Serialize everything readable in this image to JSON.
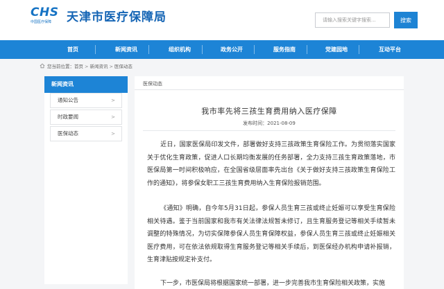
{
  "header": {
    "logo_mark": "CHS",
    "logo_sub": "中国医疗保障",
    "site_title": "天津市医疗保障局",
    "search_placeholder": "请输入搜索关键字搜索...",
    "search_button": "搜索",
    "brand_color": "#1d84d6"
  },
  "nav": {
    "items": [
      "首页",
      "新闻资讯",
      "组织机构",
      "政务公开",
      "服务指南",
      "党建园地",
      "互动平台"
    ]
  },
  "breadcrumb": {
    "prefix": "您当前位置：",
    "items": [
      "首页",
      "新闻资讯",
      "医保动态"
    ],
    "sep": ">"
  },
  "sidebar": {
    "title": "新闻资讯",
    "items": [
      {
        "label": "通知公告",
        "arrow": ">"
      },
      {
        "label": "时政要闻",
        "arrow": ">"
      },
      {
        "label": "医保动态",
        "arrow": ">"
      }
    ]
  },
  "article": {
    "section_label": "医保动态",
    "title": "我市率先将三孩生育费用纳入医疗保障",
    "date": "发布时间：2021-08-09",
    "paragraphs": [
      "近日，国家医保局印发文件，部署做好支持三孩政策生育保险工作。为贯彻落实国家关于优化生育政策，促进人口长期均衡发展的任务部署，全力支持三孩生育政策落地，市医保局第一时间积极响应，在全国省级层面率先出台《关于做好支持三孩政策生育保险工作的通知》，将参保女职工三孩生育费用纳入生育保险报销范围。",
      "《通知》明确，自今年5月31日起，参保人员生育三孩或终止妊娠可以享受生育保险相关待遇。鉴于当前国家和我市有关法律法规暂未修订，且生育服务登记等相关手续暂未调整的特殊情况，为切实保障参保人员生育保障权益，参保人员生育三孩或终止妊娠相关医疗费用，可在依法依规取得生育服务登记等相关手续后，到医保经办机构申请补报销，生育津贴按规定补支付。",
      "下一步，市医保局将根据国家统一部署，进一步完善我市生育保险相关政策，实施"
    ]
  }
}
